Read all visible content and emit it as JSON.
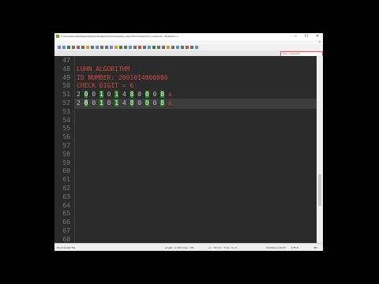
{
  "window": {
    "title": "C:\\Users\\parent\\Desktop\\Projects\\github\\tutorials\\luhn-algorithm\\notes\\luhn_notes.txt - Notepad++",
    "minimize": "─",
    "maximize": "☐",
    "close": "✕"
  },
  "menu": [
    "File",
    "Edit",
    "Search",
    "View",
    "Encoding",
    "Language",
    "Settings",
    "Tools",
    "Macro",
    "Run",
    "Plugins",
    "Window",
    "?"
  ],
  "menu_close": "X",
  "tab": {
    "label": "luhn_notes.txt"
  },
  "editor": {
    "lines": [
      {
        "num": "47",
        "text": "",
        "color": ""
      },
      {
        "num": "48",
        "text": "LUHN ALGORITHM",
        "color": "red"
      },
      {
        "num": "49",
        "text": "ID NUMBER: 2001014800086",
        "color": "red"
      },
      {
        "num": "50",
        "text": "CHECK DIGIT = 6",
        "color": "red"
      },
      {
        "num": "51",
        "digits": [
          "2",
          "0",
          "0",
          "1",
          "0",
          "1",
          "4",
          "8",
          "0",
          "0",
          "0",
          "8",
          "x"
        ]
      },
      {
        "num": "52",
        "digits": [
          "2",
          "0",
          "0",
          "1",
          "0",
          "1",
          "4",
          "8",
          "0",
          "0",
          "0",
          "8",
          "x"
        ]
      },
      {
        "num": "53"
      },
      {
        "num": "54"
      },
      {
        "num": "55"
      },
      {
        "num": "56"
      },
      {
        "num": "57"
      },
      {
        "num": "58"
      },
      {
        "num": "59"
      },
      {
        "num": "60"
      },
      {
        "num": "61"
      },
      {
        "num": "62"
      },
      {
        "num": "63"
      },
      {
        "num": "64"
      },
      {
        "num": "65"
      },
      {
        "num": "66"
      },
      {
        "num": "67"
      },
      {
        "num": "68"
      }
    ]
  },
  "status": {
    "left": "Normal text file",
    "length": "length : 1,394    lines : 68",
    "position": "Ln : 52    Col : 3    Sel : 0 | 0",
    "eol": "Windows (CR LF)",
    "encoding": "UTF-8",
    "mode": "INS"
  },
  "colors": {
    "accent_green": "#2e7d32",
    "text_red": "#d04a3c",
    "editor_bg": "#2b2b2b"
  }
}
